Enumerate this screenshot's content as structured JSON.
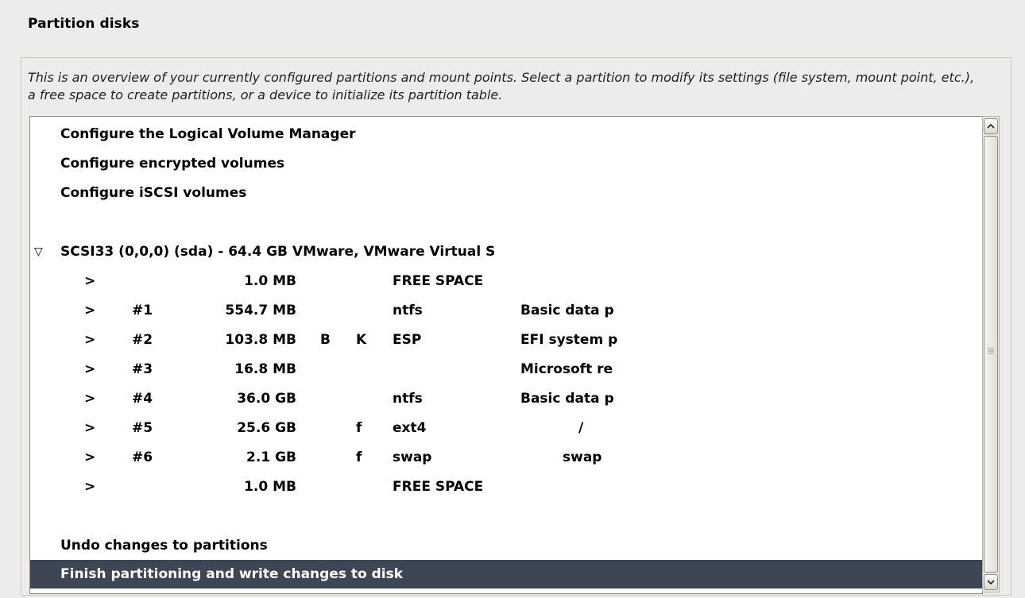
{
  "window": {
    "title": "Partition disks"
  },
  "description": "This is an overview of your currently configured partitions and mount points. Select a partition to modify its settings (file system, mount point, etc.), a free space to create partitions, or a device to initialize its partition table.",
  "actions": {
    "lvm": "Configure the Logical Volume Manager",
    "encrypted": "Configure encrypted volumes",
    "iscsi": "Configure iSCSI volumes",
    "undo": "Undo changes to partitions",
    "finish": "Finish partitioning and write changes to disk"
  },
  "disk": {
    "expander": "▽",
    "label": "SCSI33 (0,0,0) (sda) - 64.4 GB VMware, VMware Virtual S"
  },
  "partitions": [
    {
      "arrow": ">",
      "num": "",
      "size": "1.0 MB",
      "flagb": "",
      "flagk": "",
      "fs": "FREE SPACE",
      "name": ""
    },
    {
      "arrow": ">",
      "num": "#1",
      "size": "554.7 MB",
      "flagb": "",
      "flagk": "",
      "fs": "ntfs",
      "name": "Basic data p"
    },
    {
      "arrow": ">",
      "num": "#2",
      "size": "103.8 MB",
      "flagb": "B",
      "flagk": "K",
      "fs": "ESP",
      "name": "EFI system p"
    },
    {
      "arrow": ">",
      "num": "#3",
      "size": "16.8 MB",
      "flagb": "",
      "flagk": "",
      "fs": "",
      "name": "Microsoft re"
    },
    {
      "arrow": ">",
      "num": "#4",
      "size": "36.0 GB",
      "flagb": "",
      "flagk": "",
      "fs": "ntfs",
      "name": "Basic data p"
    },
    {
      "arrow": ">",
      "num": "#5",
      "size": "25.6 GB",
      "flagb": "",
      "flagk": "f",
      "fs": "ext4",
      "name": "/"
    },
    {
      "arrow": ">",
      "num": "#6",
      "size": "2.1 GB",
      "flagb": "",
      "flagk": "f",
      "fs": "swap",
      "name": "swap"
    },
    {
      "arrow": ">",
      "num": "",
      "size": "1.0 MB",
      "flagb": "",
      "flagk": "",
      "fs": "FREE SPACE",
      "name": ""
    }
  ],
  "colors": {
    "background": "#edeceb",
    "selected_row": "#3c4654",
    "selected_text": "#ffffff"
  },
  "icons": {
    "scroll_up": "chevron-up-icon",
    "scroll_down": "chevron-down-icon",
    "thumb_grip": "grip-icon",
    "disk_expander": "triangle-down-icon"
  }
}
